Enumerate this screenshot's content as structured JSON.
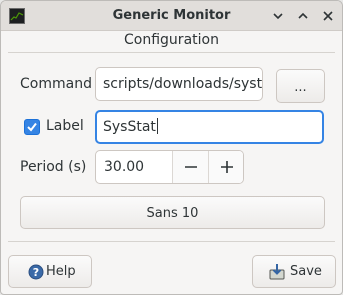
{
  "window": {
    "title": "Generic Monitor",
    "icon": "terminal-monitor-icon",
    "controls": [
      "minimize-icon",
      "maximize-icon",
      "close-icon"
    ]
  },
  "dialog": {
    "subtitle": "Configuration"
  },
  "form": {
    "command_label": "Command",
    "command_value": "scripts/downloads/systat",
    "browse_label": "...",
    "label_checkbox_label": "Label",
    "label_checked": true,
    "label_value": "SysStat",
    "period_label": "Period (s)",
    "period_value": "30.00",
    "font_button_label": "Sans 10"
  },
  "footer": {
    "help_label": "Help",
    "save_label": "Save"
  },
  "colors": {
    "accent": "#3584e4",
    "background": "#f6f5f4"
  }
}
